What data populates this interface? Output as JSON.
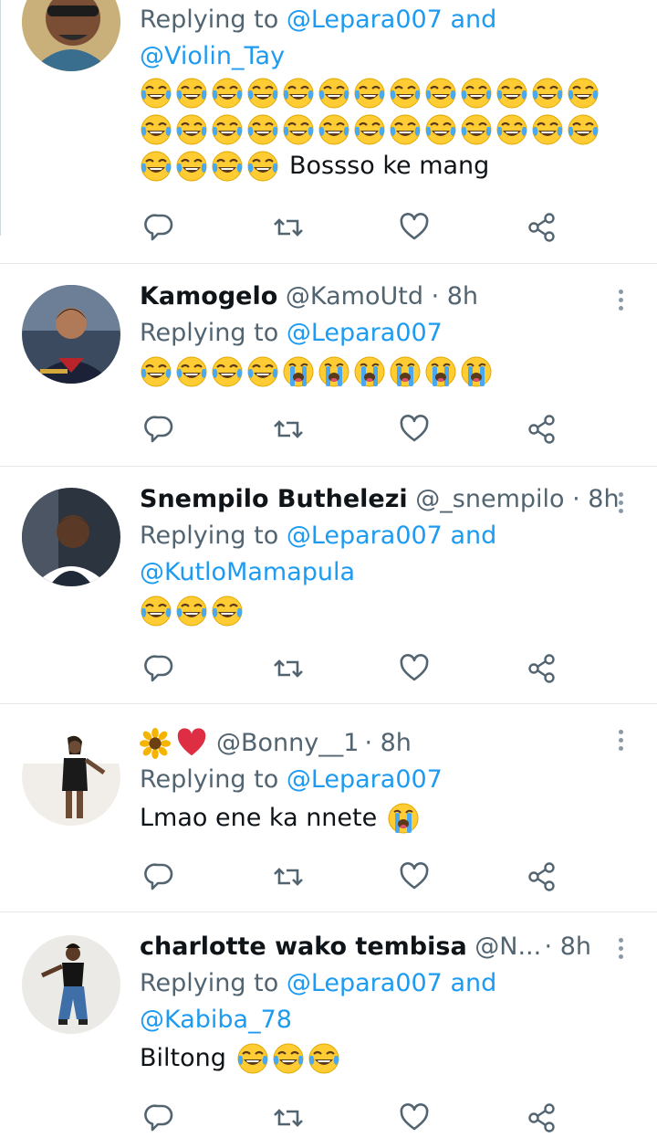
{
  "tweets": [
    {
      "reply_prefix": "Replying to",
      "reply_line1": "@Lepara007 and",
      "reply_line2": "@Violin_Tay",
      "laugh_count": 28,
      "text": "Bossso ke mang"
    },
    {
      "name": "Kamogelo",
      "handle": "@KamoUtd",
      "time": "· 8h",
      "reply_prefix": "Replying to",
      "reply_line1": "@Lepara007",
      "laugh_count": 4,
      "cry_count": 6
    },
    {
      "name": "Snempilo Buthelezi",
      "handle": "@_snempilo",
      "time": "· 8h",
      "reply_prefix": "Replying to",
      "reply_line1": "@Lepara007 and",
      "reply_line2": "@KutloMamapula",
      "laugh_count": 3
    },
    {
      "name_emojis": [
        "sunflower-icon",
        "red-heart-icon"
      ],
      "handle": "@Bonny__1",
      "time": "· 8h",
      "reply_prefix": "Replying to",
      "reply_line1": "@Lepara007",
      "text": "Lmao ene ka nnete",
      "cry_count": 1
    },
    {
      "name": "charlotte wako tembisa",
      "handle": "@N...",
      "time": "· 8h",
      "reply_prefix": "Replying to",
      "reply_line1": "@Lepara007 and",
      "reply_line2": "@Kabiba_78",
      "text": "Biltong",
      "laugh_count": 3
    }
  ],
  "colors": {
    "link": "#1d9bf0",
    "muted": "#536471",
    "divider": "#e3e7ea"
  },
  "action_icons": [
    "reply-icon",
    "retweet-icon",
    "like-icon",
    "share-icon"
  ]
}
